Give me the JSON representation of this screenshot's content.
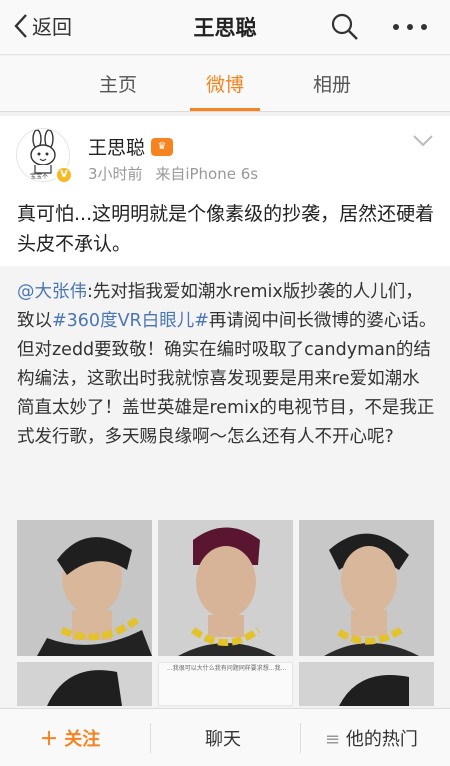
{
  "nav": {
    "back_label": "返回",
    "title": "王思聪"
  },
  "tabs": [
    {
      "label": "主页"
    },
    {
      "label": "微博"
    },
    {
      "label": "相册"
    }
  ],
  "accent_color": "#f58420",
  "link_color": "#4a77b4",
  "post": {
    "author": "王思聪",
    "time": "3小时前",
    "source": "来自iPhone 6s",
    "avatar_badge": "宝宝不",
    "text": "真可怕...这明明就是个像素级的抄袭，居然还硬着头皮不承认。"
  },
  "retweet": {
    "mention": "@大张伟",
    "text_1": ":先对指我爱如潮水remix版抄袭的人儿们，致以",
    "topic": "#360度VR白眼儿#",
    "text_2": "再请阅中间长微博的婆心话。但对zedd要致敬！确实在编时吸取了candyman的结构编法，这歌出时我就惊喜发现要是用来re爱如潮水简直太妙了！盖世英雄是remix的电视节目，不是我正式发行歌，多天赐良缘啊～怎么还有人不开心呢?",
    "image_caption": "...我很可以大什么我有问题同样要求想...我..."
  },
  "bottom": {
    "follow_label": "关注",
    "chat_label": "聊天",
    "hot_label": "他的热门"
  }
}
